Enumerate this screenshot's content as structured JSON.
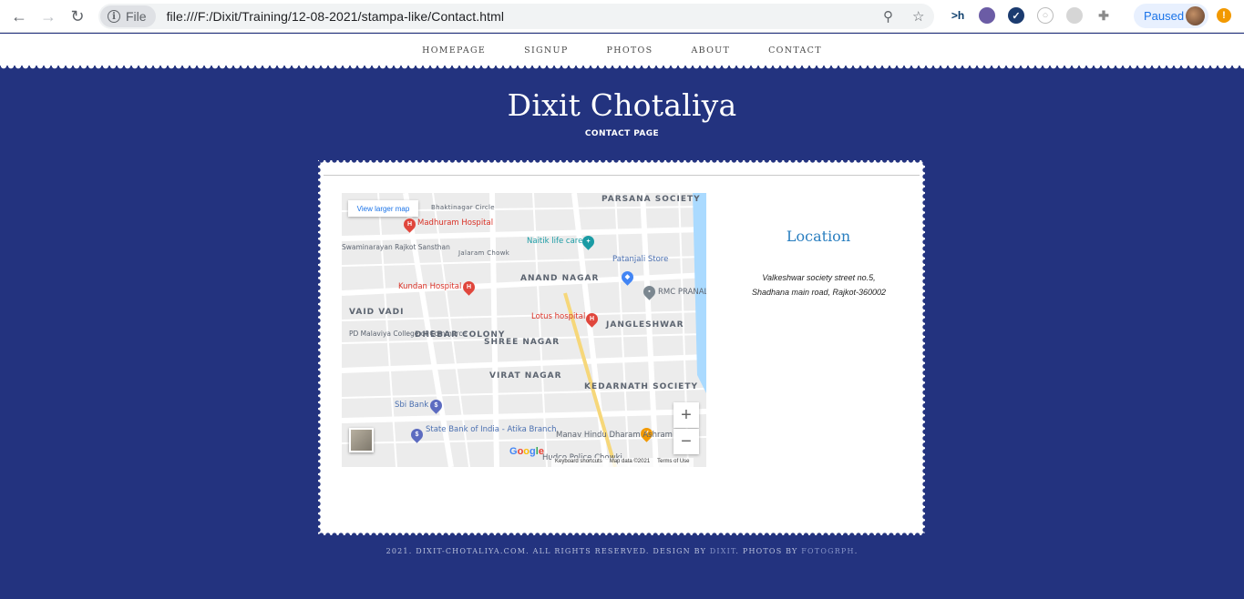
{
  "browser": {
    "scheme_label": "File",
    "url": "file:///F:/Dixit/Training/12-08-2021/stampa-like/Contact.html",
    "profile_status": "Paused",
    "extensions": [
      "hackerrank-extension",
      "globe-extension",
      "check-extension",
      "circle-extension",
      "ghost-extension",
      "puzzle-extension"
    ]
  },
  "nav": {
    "items": [
      "HOMEPAGE",
      "SIGNUP",
      "PHOTOS",
      "ABOUT",
      "CONTACT"
    ]
  },
  "header": {
    "title": "Dixit Chotaliya",
    "subtitle": "CONTACT PAGE"
  },
  "map": {
    "larger_map_label": "View larger map",
    "areas": [
      "PARSANA SOCIETY",
      "ANAND NAGAR",
      "VAID VADI",
      "DHEBAR COLONY",
      "SHREE NAGAR",
      "JANGLESHWAR",
      "VIRAT NAGAR",
      "KEDARNATH SOCIETY"
    ],
    "pois": [
      "Madhuram Hospital",
      "Naitik life care",
      "Patanjali Store",
      "Kundan Hospital",
      "RMC PRANAL",
      "Lotus hospital",
      "Sbi Bank",
      "State Bank of India - Atika Branch",
      "Manav Hindu Dharam Ashram",
      "Hudco Police Chowki",
      "PD Malaviya College of Commerce",
      "Swaminarayan Rajkot Sansthan",
      "Jalaram Chowk",
      "Bhaktinagar Circle"
    ],
    "logo": "Google",
    "attribution": [
      "Keyboard shortcuts",
      "Map data ©2021",
      "Terms of Use"
    ],
    "zoom_in": "+",
    "zoom_out": "−"
  },
  "location": {
    "title": "Location",
    "address_line1": "Valkeshwar society street no.5,",
    "address_line2": "Shadhana main road, Rajkot-360002"
  },
  "footer": {
    "text": "2021. DIXIT-CHOTALIYA.COM. ALL RIGHTS RESERVED. DESIGN BY",
    "design_link": "DIXIT",
    "photos_text": ". PHOTOS BY",
    "photos_link": "FOTOGRPH",
    "end": "."
  },
  "colors": {
    "page_background": "#23337f",
    "accent_blue": "#2a7fc0"
  }
}
